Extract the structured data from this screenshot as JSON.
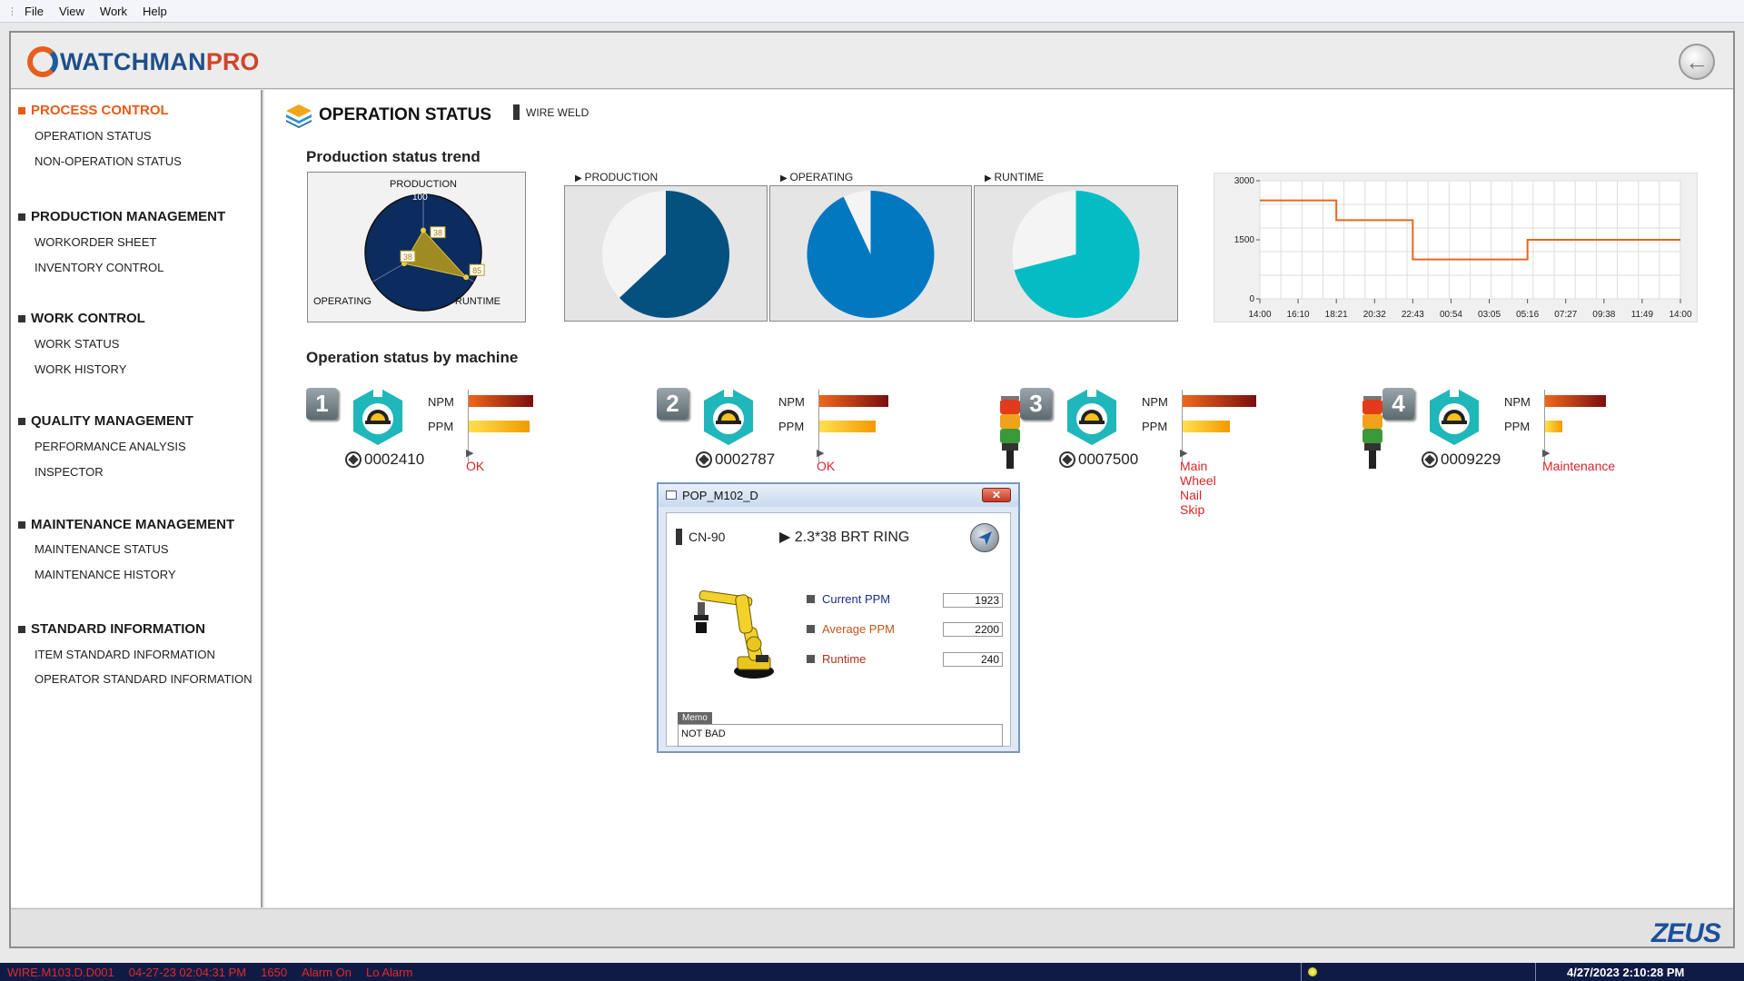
{
  "menu": [
    "File",
    "View",
    "Work",
    "Help"
  ],
  "brand": {
    "part1": "WATCHMAN",
    "part2": "PRO"
  },
  "footer_brand": "ZEUS",
  "sidebar": [
    {
      "title": "PROCESS CONTROL",
      "items": [
        "OPERATION STATUS",
        "NON-OPERATION STATUS"
      ]
    },
    {
      "title": "PRODUCTION MANAGEMENT",
      "items": [
        "WORKORDER SHEET",
        "INVENTORY CONTROL"
      ]
    },
    {
      "title": "WORK CONTROL",
      "items": [
        "WORK STATUS",
        "WORK HISTORY"
      ]
    },
    {
      "title": "QUALITY MANAGEMENT",
      "items": [
        "PERFORMANCE ANALYSIS",
        "INSPECTOR"
      ]
    },
    {
      "title": "MAINTENANCE MANAGEMENT",
      "items": [
        "MAINTENANCE STATUS",
        "MAINTENANCE HISTORY"
      ]
    },
    {
      "title": "STANDARD INFORMATION",
      "items": [
        "ITEM STANDARD INFORMATION",
        "OPERATOR STANDARD INFORMATION"
      ]
    }
  ],
  "page": {
    "title": "OPERATION STATUS",
    "tag": "WIRE WELD",
    "trend_title": "Production status trend",
    "machine_title": "Operation status by machine"
  },
  "chart_data": [
    {
      "type": "radar",
      "axes": [
        "PRODUCTION",
        "RUNTIME",
        "OPERATING"
      ],
      "max_label": "100",
      "values": [
        38,
        85,
        38
      ],
      "value_labels": [
        "38",
        "85",
        "38"
      ]
    },
    {
      "type": "pie",
      "title": "PRODUCTION",
      "value_percent": 63,
      "color": "#04507f"
    },
    {
      "type": "pie",
      "title": "OPERATING",
      "value_percent": 93,
      "color": "#0278c0"
    },
    {
      "type": "pie",
      "title": "RUNTIME",
      "value_percent": 71,
      "color": "#03bcc4"
    },
    {
      "type": "line",
      "x": [
        "14:00",
        "16:10",
        "18:21",
        "20:32",
        "22:43",
        "00:54",
        "03:05",
        "05:16",
        "07:27",
        "09:38",
        "11:49",
        "14:00"
      ],
      "yticks": [
        "3000",
        "1500",
        "0"
      ],
      "ylim": [
        0,
        3000
      ],
      "values": [
        2500,
        2500,
        2000,
        2000,
        1000,
        1000,
        1000,
        1500,
        1500,
        1500,
        1500,
        1500
      ],
      "color": "#e8661c",
      "grid": true
    }
  ],
  "machines": [
    {
      "num": "1",
      "id": "0002410",
      "npm_label": "NPM",
      "ppm_label": "PPM",
      "npm": 0.75,
      "ppm": 0.7,
      "status": "OK",
      "tower": false
    },
    {
      "num": "2",
      "id": "0002787",
      "npm_label": "NPM",
      "ppm_label": "PPM",
      "npm": 0.8,
      "ppm": 0.65,
      "status": "OK",
      "tower": false
    },
    {
      "num": "3",
      "id": "0007500",
      "npm_label": "NPM",
      "ppm_label": "PPM",
      "npm": 0.85,
      "ppm": 0.55,
      "status": "Main Wheel Nail Skip",
      "tower": true
    },
    {
      "num": "4",
      "id": "0009229",
      "npm_label": "NPM",
      "ppm_label": "PPM",
      "npm": 0.7,
      "ppm": 0.2,
      "status": "Maintenance",
      "tower": true
    }
  ],
  "popup": {
    "title": "POP_M102_D",
    "close": "✕",
    "code": "CN-90",
    "item": "2.3*38 BRT RING",
    "fields": [
      {
        "label": "Current PPM",
        "value": "1923",
        "color": "#1b2f8c"
      },
      {
        "label": "Average PPM",
        "value": "2200",
        "color": "#c0561b"
      },
      {
        "label": "Runtime",
        "value": "240",
        "color": "#b0301d"
      }
    ],
    "memo_label": "Memo",
    "memo": "NOT BAD"
  },
  "statusbar": {
    "items": [
      "WIRE.M103.D.D001",
      "04-27-23 02:04:31 PM",
      "1650",
      "Alarm On",
      "Lo Alarm"
    ],
    "time": "4/27/2023 2:10:28 PM"
  }
}
